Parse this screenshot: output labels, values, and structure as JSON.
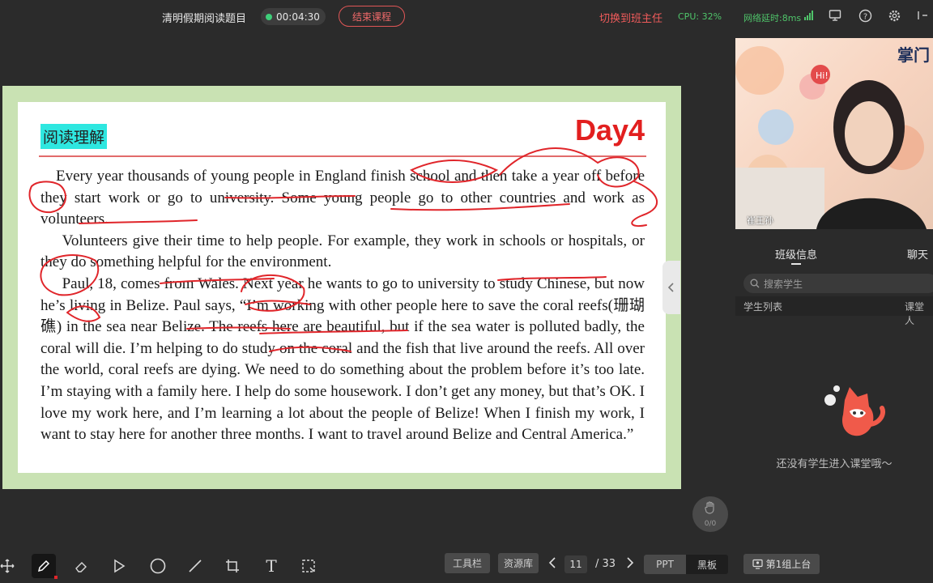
{
  "topbar": {
    "title": "清明假期阅读题目",
    "timer": "00:04:30",
    "end_button": "结束课程",
    "switch_teacher": "切换到班主任",
    "cpu": "CPU: 32%",
    "latency": "网络延时:8ms",
    "icons": [
      "screen-share-icon",
      "help-icon",
      "gear-icon",
      "minimize-icon"
    ]
  },
  "slide": {
    "heading": "阅读理解",
    "day_label": "Day4",
    "paragraphs": [
      "Every year thousands of young people in England finish school and then take a year off before they start work or go to university. Some young people go to other countries and work as volunteers.",
      "Volunteers give their time to help people. For example, they work in schools or hospitals, or they do something helpful for the environment.",
      "Paul, 18, comes from Wales. Next year he wants to go to university to study Chinese, but now he’s living in Belize. Paul says, “I’m working with other people here to save the coral reefs(珊瑚礁) in the sea near Belize. The reefs here are beautiful, but if the sea water is polluted badly, the coral will die. I’m helping to do study on the coral and the fish that live around the reefs. All over the world, coral reefs are dying. We need to do something about the problem before it’s too late. I’m staying with a family here. I help do some housework. I don’t get any money, but that’s OK. I love my work here, and I’m learning a lot about the people of Belize! When I finish my work, I want to stay here for another three months. I want to travel around Belize and Central America.”"
    ],
    "annotation_color": "#e0252a"
  },
  "hand_raise": {
    "count": "0/0"
  },
  "toolbar": {
    "tools": [
      "move-icon",
      "pen-icon",
      "eraser-icon",
      "pointer-icon",
      "circle-icon",
      "line-icon",
      "crop-icon",
      "text-icon",
      "select-icon"
    ],
    "text_tool": "T",
    "tools_button": "工具栏",
    "resources_button": "资源库",
    "current_page": "11",
    "total_pages": "/ 33",
    "mode_ppt": "PPT",
    "mode_blackboard": "黑板"
  },
  "video": {
    "brand_text": "掌门",
    "name": "崔王孙"
  },
  "panel": {
    "tab_class_info": "班级信息",
    "tab_chat": "聊天",
    "search_placeholder": "搜索学生",
    "student_list": "学生列表",
    "classroom_col": "课堂人",
    "empty_message": "还没有学生进入课堂哦～",
    "onstage_button": "第1组上台"
  }
}
